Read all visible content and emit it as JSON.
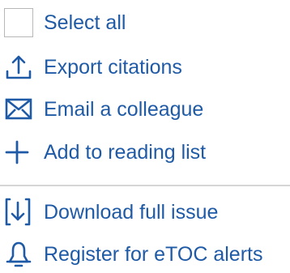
{
  "actions": {
    "select_all": {
      "label": "Select all",
      "icon": "checkbox-icon",
      "checked": false
    },
    "export_citations": {
      "label": "Export citations",
      "icon": "export-icon"
    },
    "email_colleague": {
      "label": "Email a colleague",
      "icon": "envelope-icon"
    },
    "add_reading_list": {
      "label": "Add to reading list",
      "icon": "plus-icon"
    },
    "download_issue": {
      "label": "Download full issue",
      "icon": "download-icon"
    },
    "register_etoc": {
      "label": "Register for eTOC alerts",
      "icon": "bell-icon"
    }
  },
  "colors": {
    "link": "#1f5aa6",
    "icon": "#1f5aa6",
    "divider": "#d6d6d6",
    "checkbox_border": "#b8b8b8"
  }
}
